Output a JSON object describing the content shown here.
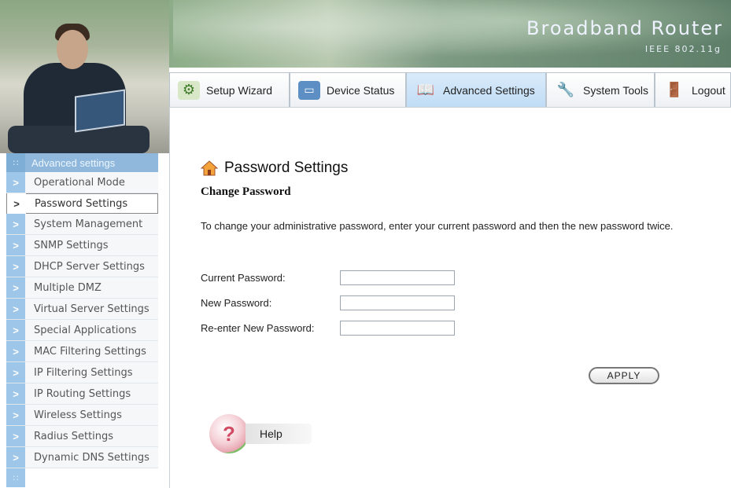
{
  "header": {
    "brand": "Broadband Router",
    "sub": "IEEE 802.11g"
  },
  "tabs": [
    {
      "label": "Setup Wizard",
      "icon": "setup-wizard-icon"
    },
    {
      "label": "Device Status",
      "icon": "monitor-icon"
    },
    {
      "label": "Advanced Settings",
      "icon": "book-icon",
      "active": true
    },
    {
      "label": "System Tools",
      "icon": "tools-icon"
    },
    {
      "label": "Logout",
      "icon": "logout-icon"
    }
  ],
  "sidebar": {
    "heading": "Advanced settings",
    "dots": "∷",
    "items": [
      {
        "label": "Operational Mode"
      },
      {
        "label": "Password Settings",
        "active": true
      },
      {
        "label": "System Management"
      },
      {
        "label": "SNMP Settings"
      },
      {
        "label": "DHCP Server Settings"
      },
      {
        "label": "Multiple DMZ"
      },
      {
        "label": "Virtual Server Settings"
      },
      {
        "label": "Special Applications"
      },
      {
        "label": "MAC Filtering Settings"
      },
      {
        "label": "IP Filtering Settings"
      },
      {
        "label": "IP Routing Settings"
      },
      {
        "label": "Wireless Settings"
      },
      {
        "label": "Radius Settings"
      },
      {
        "label": "Dynamic DNS Settings"
      }
    ]
  },
  "main": {
    "title": "Password Settings",
    "subtitle": "Change Password",
    "description": "To change your administrative password, enter your current password and then the new password twice.",
    "fields": {
      "current": {
        "label": "Current Password:",
        "value": ""
      },
      "new": {
        "label": "New Password:",
        "value": ""
      },
      "reenter": {
        "label": "Re-enter New Password:",
        "value": ""
      }
    },
    "apply_label": "APPLY",
    "help_label": "Help"
  },
  "colors": {
    "sidebar_accent": "#9ec6e8",
    "active_tab": "#c0dcf5"
  }
}
